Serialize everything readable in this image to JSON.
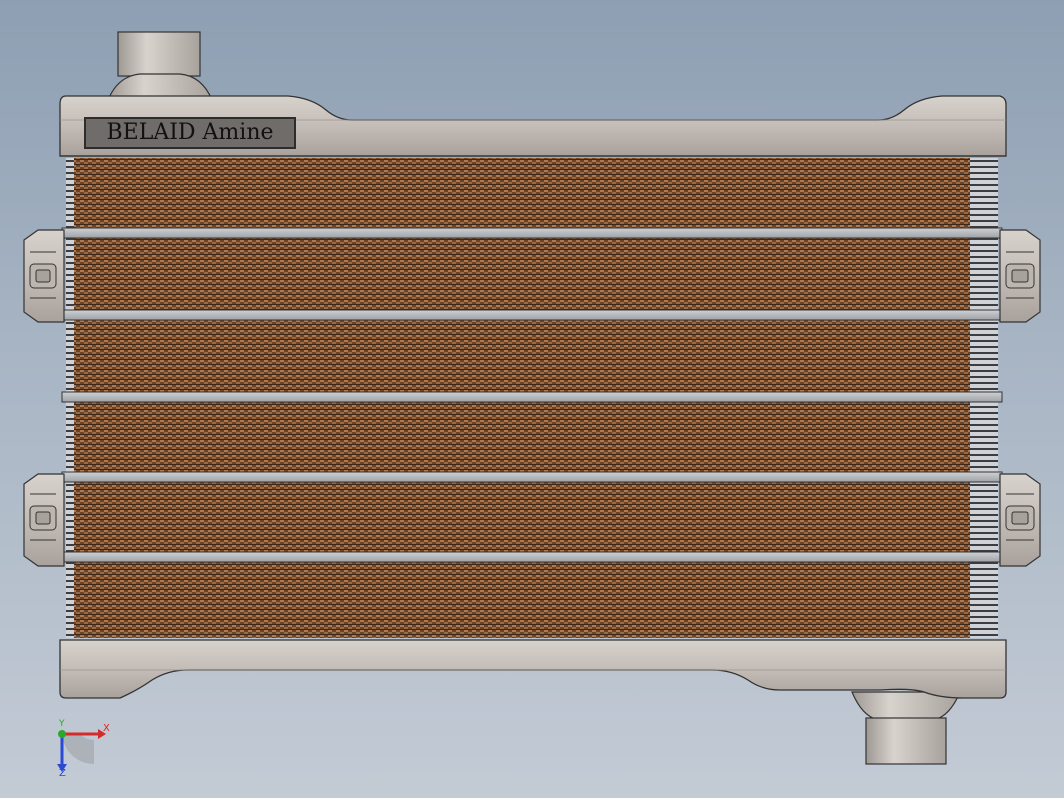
{
  "model": {
    "label_text": "BELAID Amine"
  },
  "triad": {
    "x_label": "X",
    "y_label": "Y",
    "z_label": "Z",
    "x_color": "#d42a2a",
    "y_color": "#2aa82a",
    "z_color": "#2a4ad4"
  },
  "colors": {
    "background_top": "#8e9fb3",
    "background_bottom": "#c3cbd5",
    "tank_metal": "#c9c2bc",
    "fin_copper": "#8a5a38",
    "bar_grey": "#b7b9bc"
  }
}
